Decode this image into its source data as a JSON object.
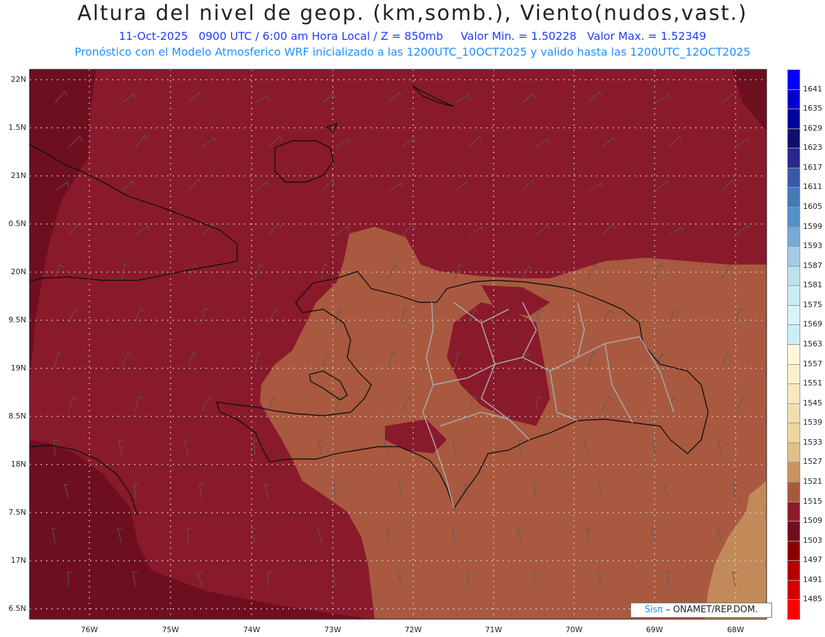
{
  "title": "Altura del nivel de geop. (km,somb.), Viento(nudos,vast.)",
  "subtitle_line1": "11-Oct-2025   0900 UTC / 6:00 am Hora Local / Z = 850mb     Valor Min. = 1.50228   Valor Max. = 1.52349",
  "subtitle_line2": "Pronóstico con el Modelo Atmosferico WRF inicializado a las 1200UTC_10OCT2025 y valido hasta las  1200UTC_12OCT2025",
  "lat_labels": [
    "22N",
    "1.5N",
    "21N",
    "0.5N",
    "20N",
    "9.5N",
    "19N",
    "8.5N",
    "18N",
    "7.5N",
    "17N",
    "6.5N"
  ],
  "lon_labels": [
    "76W",
    "75W",
    "74W",
    "73W",
    "72W",
    "71W",
    "70W",
    "69W",
    "68W"
  ],
  "colorbar": {
    "labels": [
      "1641",
      "1635",
      "1629",
      "1623",
      "1617",
      "1611",
      "1605",
      "1599",
      "1593",
      "1587",
      "1581",
      "1575",
      "1569",
      "1563",
      "1557",
      "1551",
      "1545",
      "1539",
      "1533",
      "1527",
      "1521",
      "1515",
      "1509",
      "1503",
      "1497",
      "1491",
      "1485"
    ],
    "colors": [
      "#0000ff",
      "#0000cc",
      "#00009a",
      "#0e0e6e",
      "#27288c",
      "#3a58a8",
      "#4778b8",
      "#5690c8",
      "#78aad8",
      "#a2cce6",
      "#bce2ee",
      "#c8ecf4",
      "#d8f4fa",
      "#c6f0f6",
      "#fff7d8",
      "#fbf0cc",
      "#f7e8bd",
      "#f1dfae",
      "#ecd6a0",
      "#dfc08c",
      "#c99463",
      "#a8583e",
      "#8b1c2b",
      "#6e0e20",
      "#8a0000",
      "#b30000",
      "#d20000",
      "#ff0000"
    ]
  },
  "colors": {
    "dark_region": "#891a2b",
    "darker_region": "#6e0f20",
    "light_region": "#a9593f",
    "lighter_region": "#c28a58",
    "coastline": "#111111",
    "borders": "#a8a8a8",
    "grid": "#d8d8d8"
  },
  "credit": {
    "logo": "Sisπ",
    "text": "– ONAMET/REP.DOM."
  }
}
